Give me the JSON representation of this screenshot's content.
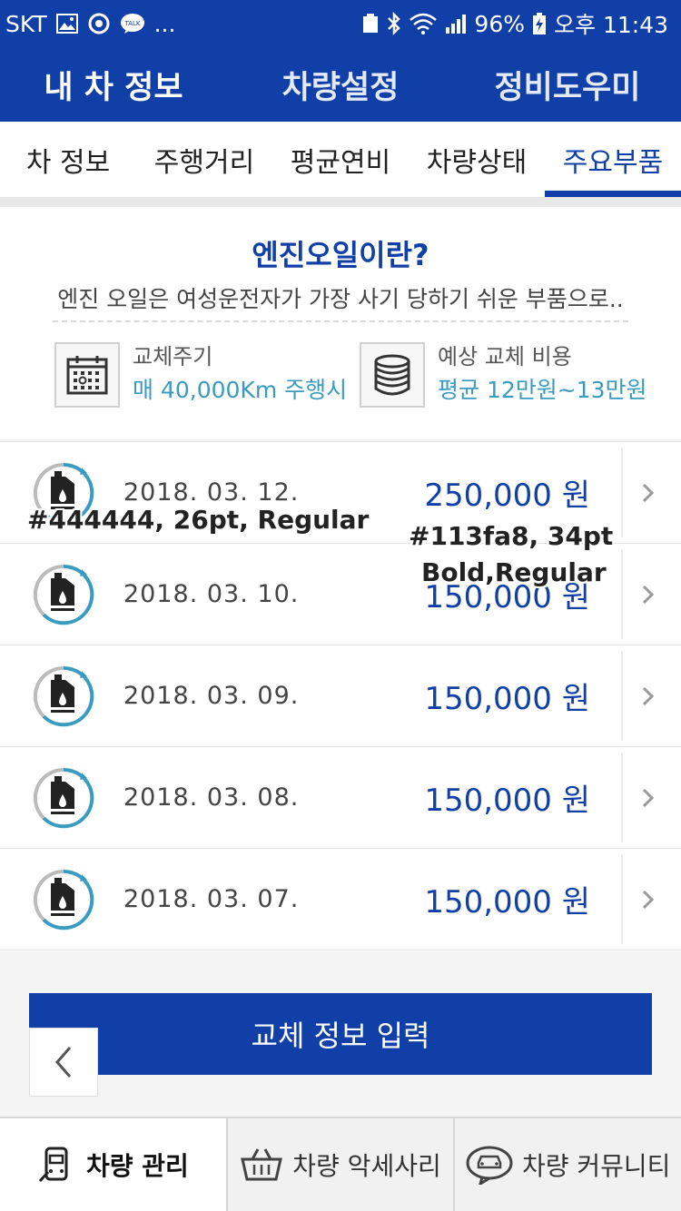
{
  "status_bar": {
    "carrier": "SKT",
    "more": "...",
    "battery": "96%",
    "time": "오후 11:43"
  },
  "top_nav": [
    {
      "label": "내 차 정보",
      "active": true
    },
    {
      "label": "차량설정",
      "active": false
    },
    {
      "label": "정비도우미",
      "active": false
    }
  ],
  "sub_tabs": [
    {
      "label": "차 정보"
    },
    {
      "label": "주행거리"
    },
    {
      "label": "평균연비"
    },
    {
      "label": "차량상태"
    },
    {
      "label": "주요부품",
      "active": true
    }
  ],
  "info": {
    "title": "엔진오일이란?",
    "description": "엔진 오일은 여성운전자가 가장 사기 당하기 쉬운 부품으로..",
    "cycle_label": "교체주기",
    "cycle_value": "매 40,000Km 주행시",
    "cost_label": "예상 교체 비용",
    "cost_value": "평균 12만원~13만원"
  },
  "records": [
    {
      "date": "2018. 03. 12.",
      "price": "250,000 원"
    },
    {
      "date": "2018. 03. 10.",
      "price": "150,000 원"
    },
    {
      "date": "2018. 03. 09.",
      "price": "150,000 원"
    },
    {
      "date": "2018. 03. 08.",
      "price": "150,000 원"
    },
    {
      "date": "2018. 03. 07.",
      "price": "150,000 원"
    }
  ],
  "annotations": {
    "date_style": "#444444, 26pt, Regular",
    "price_style_line1": "#113fa8, 34pt",
    "price_style_line2": "Bold,Regular"
  },
  "input_button": "교체 정보 입력",
  "bottom_nav": [
    {
      "label": "차량 관리",
      "icon": "car-manage-icon"
    },
    {
      "label": "차량 악세사리",
      "icon": "basket-icon"
    },
    {
      "label": "차량 커뮤니티",
      "icon": "car-chat-icon"
    }
  ],
  "colors": {
    "primary": "#113fa8",
    "accent": "#3a9bc1",
    "text": "#444444"
  }
}
